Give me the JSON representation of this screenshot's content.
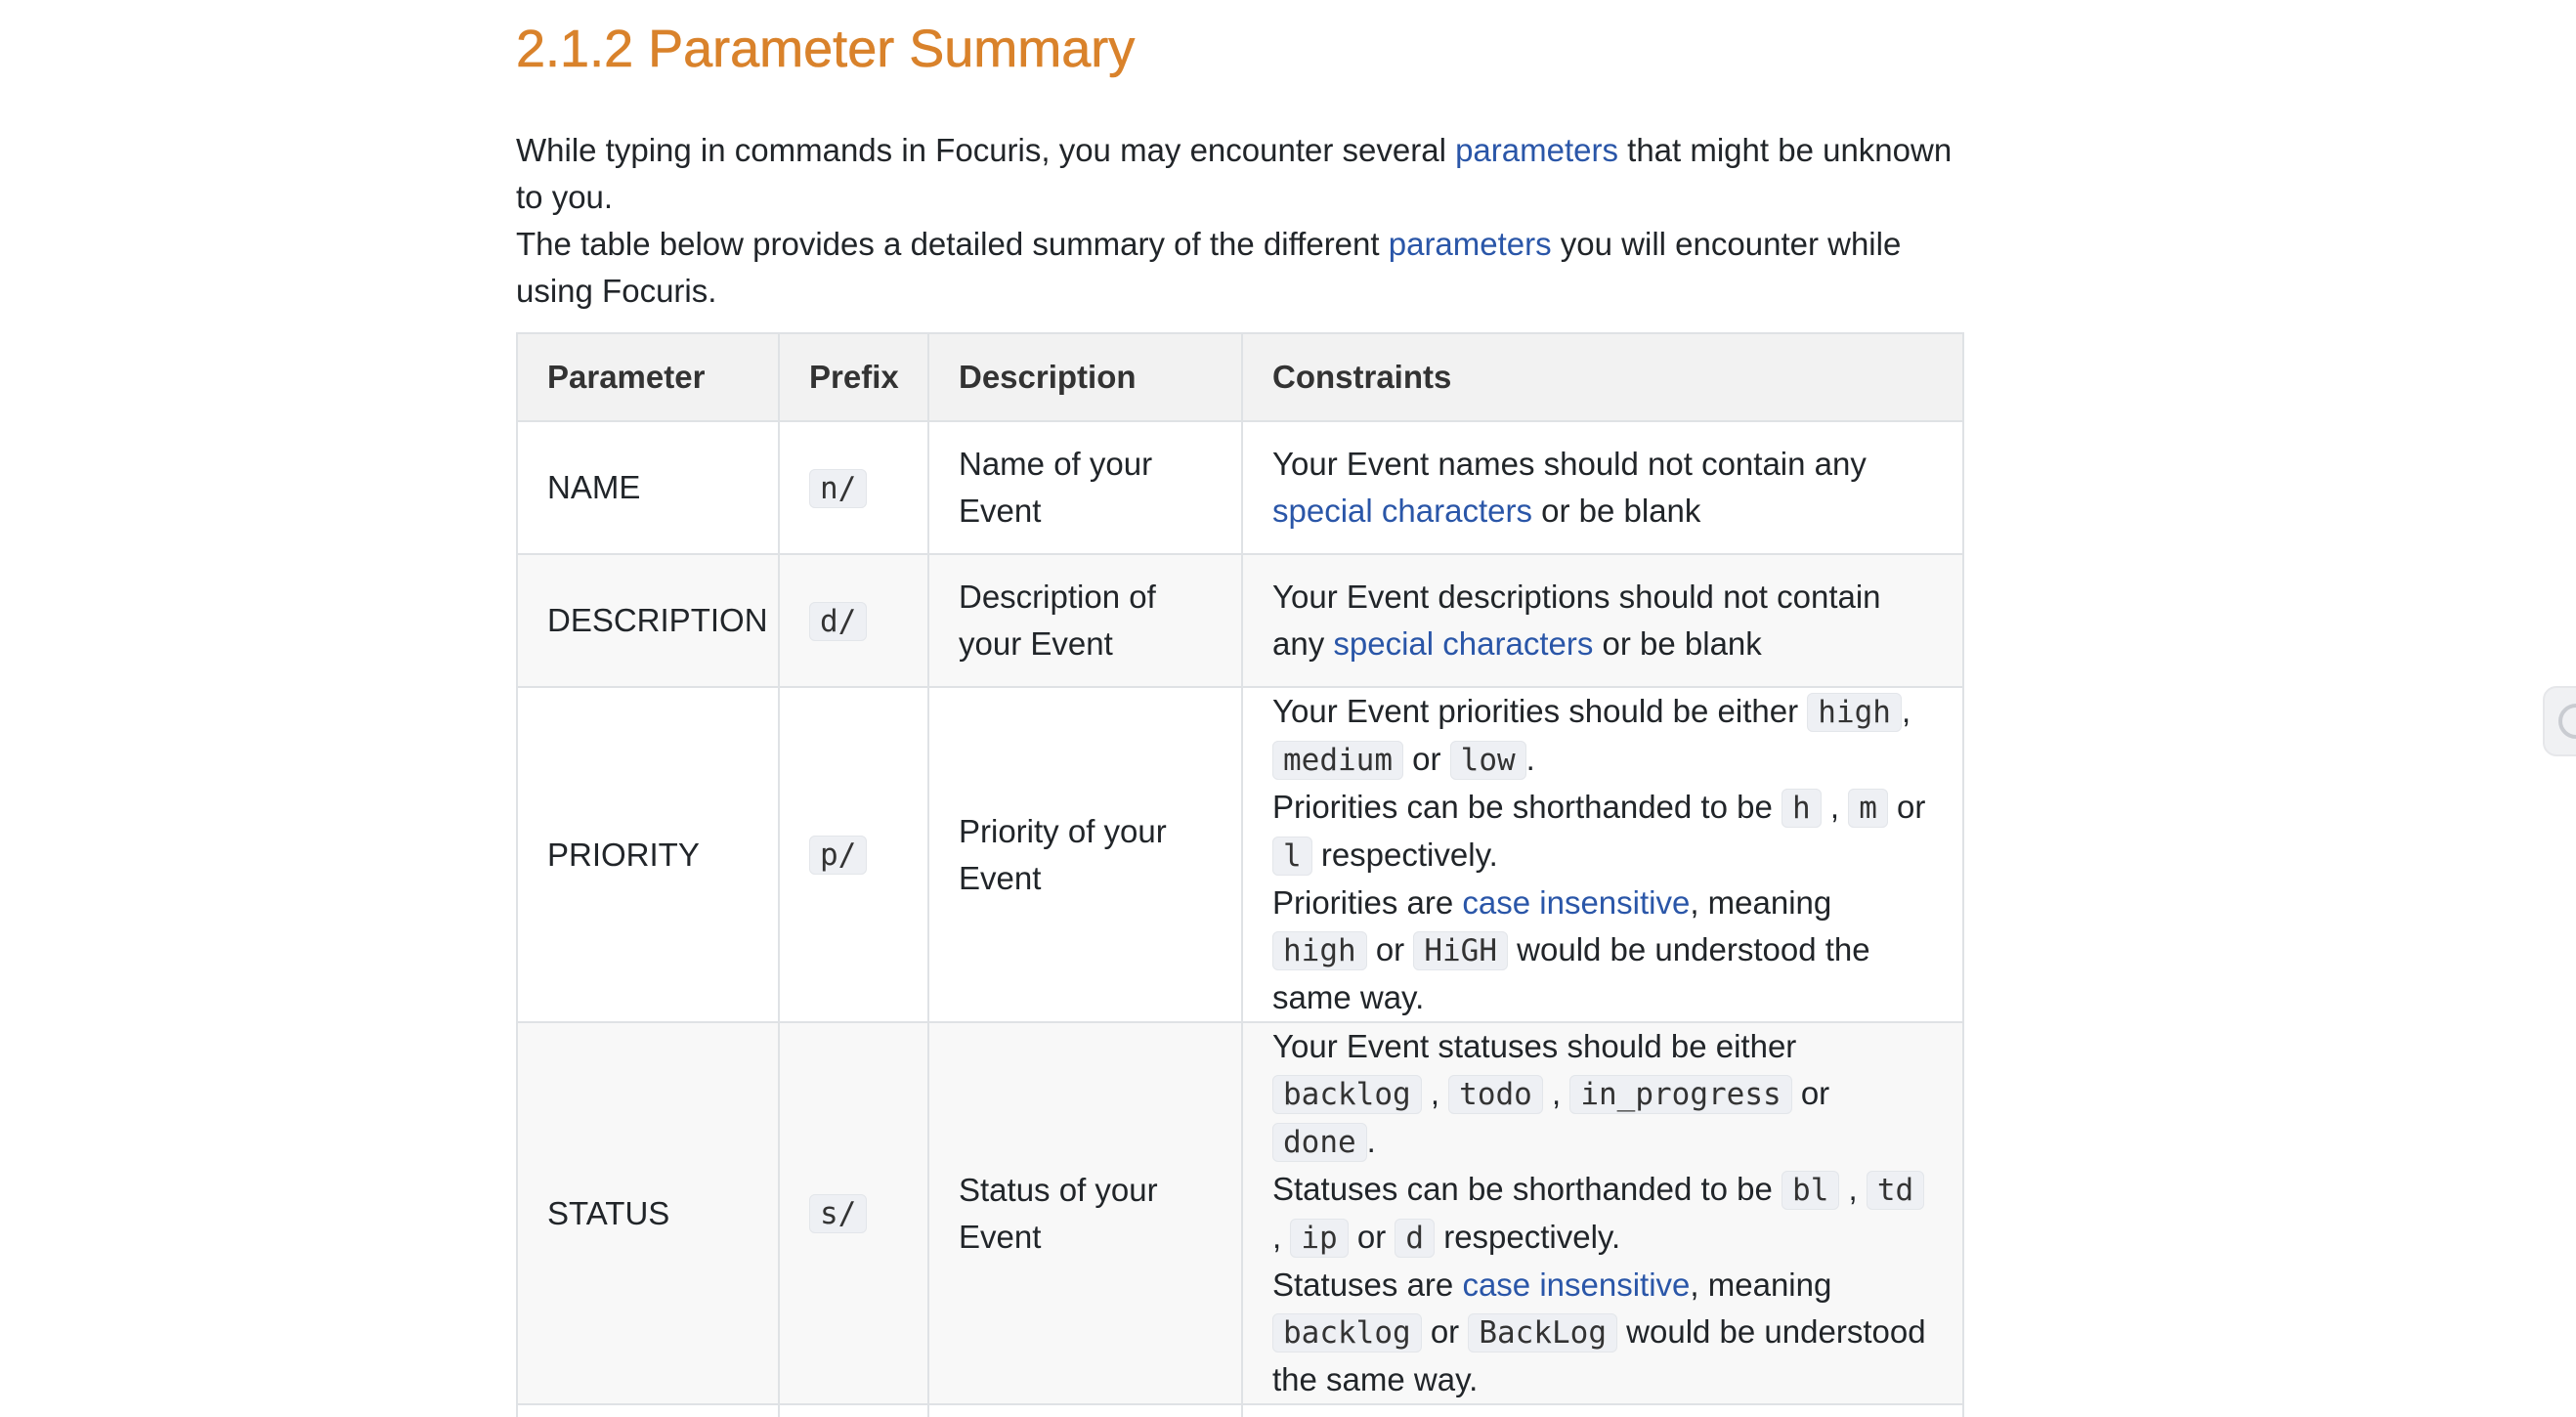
{
  "heading": "2.1.2 Parameter Summary",
  "intro": {
    "line1_before": "While typing in commands in Focuris, you may encounter several ",
    "line1_link": "parameters",
    "line1_after": " that might be unknown to you.",
    "line2_before": "The table below provides a detailed summary of the different ",
    "line2_link": "parameters",
    "line2_after": " you will encounter while using Focuris."
  },
  "table": {
    "headers": [
      "Parameter",
      "Prefix",
      "Description",
      "Constraints"
    ],
    "rows": [
      {
        "parameter": "NAME",
        "prefix": "n/",
        "description": "Name of your Event",
        "c1": "Your Event names should not contain any ",
        "c_link": "special characters",
        "c2": " or be blank"
      },
      {
        "parameter": "DESCRIPTION",
        "prefix": "d/",
        "description": "Description of your Event",
        "c1": "Your Event descriptions should not contain any ",
        "c_link": "special characters",
        "c2": " or be blank"
      },
      {
        "parameter": "PRIORITY",
        "prefix": "p/",
        "description": "Priority of your Event",
        "a1": "Your Event priorities should be either ",
        "high": "high",
        "a2": ", ",
        "medium": "medium",
        "a3": " or ",
        "low": "low",
        "a4": ".",
        "b1": "Priorities can be shorthanded to be ",
        "h": "h",
        "b2": " , ",
        "m": "m",
        "b3": " or ",
        "l": "l",
        "b4": " respectively.",
        "c1": "Priorities are ",
        "c_link": "case insensitive",
        "c2": ", meaning ",
        "high2": "high",
        "c3": " or ",
        "HiGH": "HiGH",
        "c4": " would be understood the same way."
      },
      {
        "parameter": "STATUS",
        "prefix": "s/",
        "description": "Status of your Event",
        "a1": "Your Event statuses should be either ",
        "backlog": "backlog",
        "a2": " , ",
        "todo": "todo",
        "a3": " , ",
        "in_progress": "in_progress",
        "a4": " or ",
        "done": "done",
        "a5": ".",
        "b1": "Statuses can be shorthanded to be ",
        "bl": "bl",
        "b2": " , ",
        "td": "td",
        "b3": " , ",
        "ip": "ip",
        "b4": " or ",
        "d": "d",
        "b5": " respectively.",
        "c1": "Statuses are ",
        "c_link": "case insensitive",
        "c2": ", meaning ",
        "backlog2": "backlog",
        "c3": " or ",
        "BackLog": "BackLog",
        "c4": " would be understood the same way."
      }
    ]
  }
}
